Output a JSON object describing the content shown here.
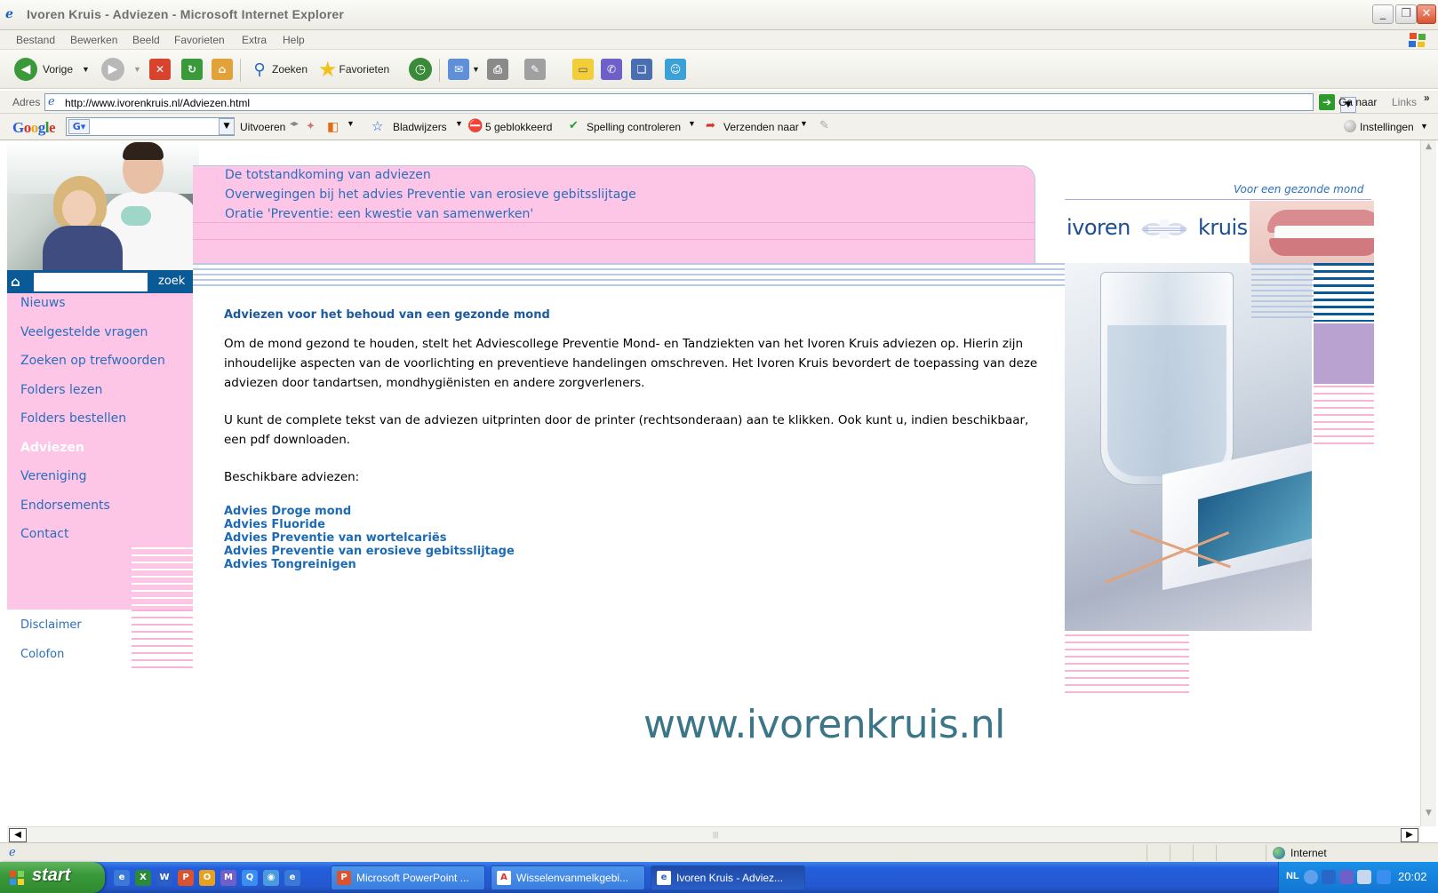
{
  "window": {
    "title": "Ivoren Kruis - Adviezen - Microsoft Internet Explorer",
    "buttons": {
      "minimize": "_",
      "maximize": "❐",
      "close": "✕"
    }
  },
  "menu": [
    "Bestand",
    "Bewerken",
    "Beeld",
    "Favorieten",
    "Extra",
    "Help"
  ],
  "toolbar": {
    "back_label": "Vorige",
    "search_label": "Zoeken",
    "favorites_label": "Favorieten",
    "icons": [
      "back-arrow",
      "forward-arrow",
      "stop",
      "refresh",
      "home",
      "search",
      "favorites-star",
      "history",
      "mail",
      "print",
      "edit",
      "discuss",
      "messenger",
      "research",
      "msn-people"
    ]
  },
  "address": {
    "label": "Adres",
    "url": "http://www.ivorenkruis.nl/Adviezen.html",
    "go_label": "Ga naar",
    "links_label": "Links",
    "chevron": "»"
  },
  "googlebar": {
    "logo": "Google",
    "g_button": "G▾",
    "search_value": "",
    "run_label": "Uitvoeren",
    "bookmarks_label": "Bladwijzers",
    "blocked_label": "5 geblokkeerd",
    "spelling_label": "Spelling controleren",
    "send_label": "Verzenden naar",
    "settings_label": "Instellingen",
    "colors": {
      "g_blue": "#2a5fd6",
      "g_red": "#d9302c",
      "g_yellow": "#e8a912",
      "g_green": "#2a9a3a"
    }
  },
  "site": {
    "search": {
      "value": "",
      "button": "zoek"
    },
    "nav": [
      "Nieuws",
      "Veelgestelde vragen",
      "Zoeken op trefwoorden",
      "Folders lezen",
      "Folders bestellen",
      "Adviezen",
      "Vereniging",
      "Endorsements",
      "Contact"
    ],
    "active_nav": "Adviezen",
    "footer_links": [
      "Disclaimer",
      "Colofon"
    ],
    "top_links": [
      "De totstandkoming van adviezen",
      "Overwegingen bij het advies Preventie van erosieve gebitsslijtage",
      "Oratie 'Preventie: een kwestie van samenwerken'"
    ],
    "tagline": "Voor een gezonde mond",
    "logo": {
      "left": "ivoren",
      "right": "kruis"
    },
    "heading": "Adviezen voor het behoud van een gezonde mond",
    "paragraphs": [
      "Om de mond gezond te houden, stelt het Adviescollege Preventie Mond- en Tandziekten van het Ivoren Kruis adviezen op. Hierin zijn inhoudelijke aspecten van de voorlichting en preventieve handelingen omschreven. Het Ivoren Kruis bevordert de toepassing van deze adviezen door tandartsen, mondhygiënisten en andere zorgverleners.",
      "U kunt de complete tekst van de adviezen uitprinten door de printer (rechtsonderaan) aan te klikken. Ook kunt u, indien beschikbaar, een pdf downloaden.",
      "Beschikbare adviezen:"
    ],
    "advice_links": [
      "Advies Droge mond",
      "Advies Fluoride",
      "Advies Preventie van wortelcariës",
      "Advies Preventie van erosieve gebitsslijtage",
      "Advies Tongreinigen"
    ],
    "colors": {
      "pink": "#fdc6e6",
      "nav_blue": "#0b5a98",
      "link_blue": "#2a6ebd",
      "heading_blue": "#1d5a9f"
    }
  },
  "overlay_url": "www.ivorenkruis.nl",
  "statusbar": {
    "zone": "Internet"
  },
  "taskbar": {
    "start_label": "start",
    "tasks": [
      "Microsoft PowerPoint ...",
      "Wisselenvanmelkgebi...",
      "Ivoren Kruis - Adviez..."
    ],
    "active_task": "Ivoren Kruis - Adviez...",
    "tray_lang": "NL",
    "clock": "20:02"
  }
}
